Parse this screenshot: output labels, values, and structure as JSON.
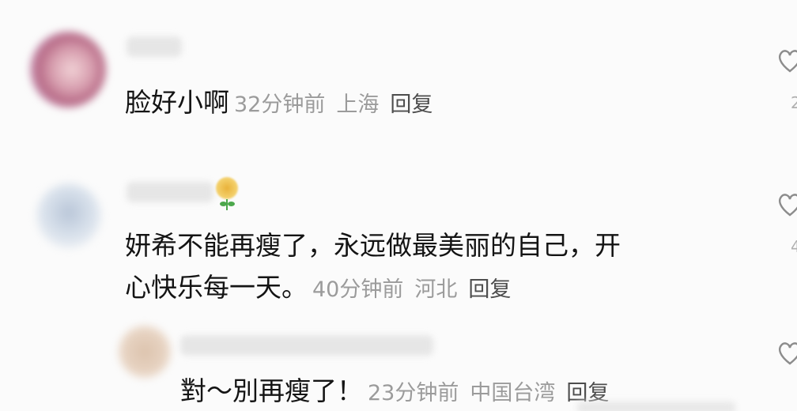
{
  "comments": [
    {
      "text": "脸好小啊",
      "time": "32分钟前",
      "location": "上海",
      "reply_label": "回复"
    },
    {
      "text_line1": "妍希不能再瘦了，永远做最美丽的自己，开",
      "text_line2": "心快乐每一天。",
      "time": "40分钟前",
      "location": "河北",
      "reply_label": "回复"
    },
    {
      "text": "對～別再瘦了！",
      "time": "23分钟前",
      "location": "中国台湾",
      "reply_label": "回复"
    }
  ],
  "icons": {
    "like": "heart-icon",
    "badge": "sunflower-icon"
  },
  "colors": {
    "text": "#141414",
    "meta": "#9b9b9b",
    "reply": "#4d4d4d"
  }
}
